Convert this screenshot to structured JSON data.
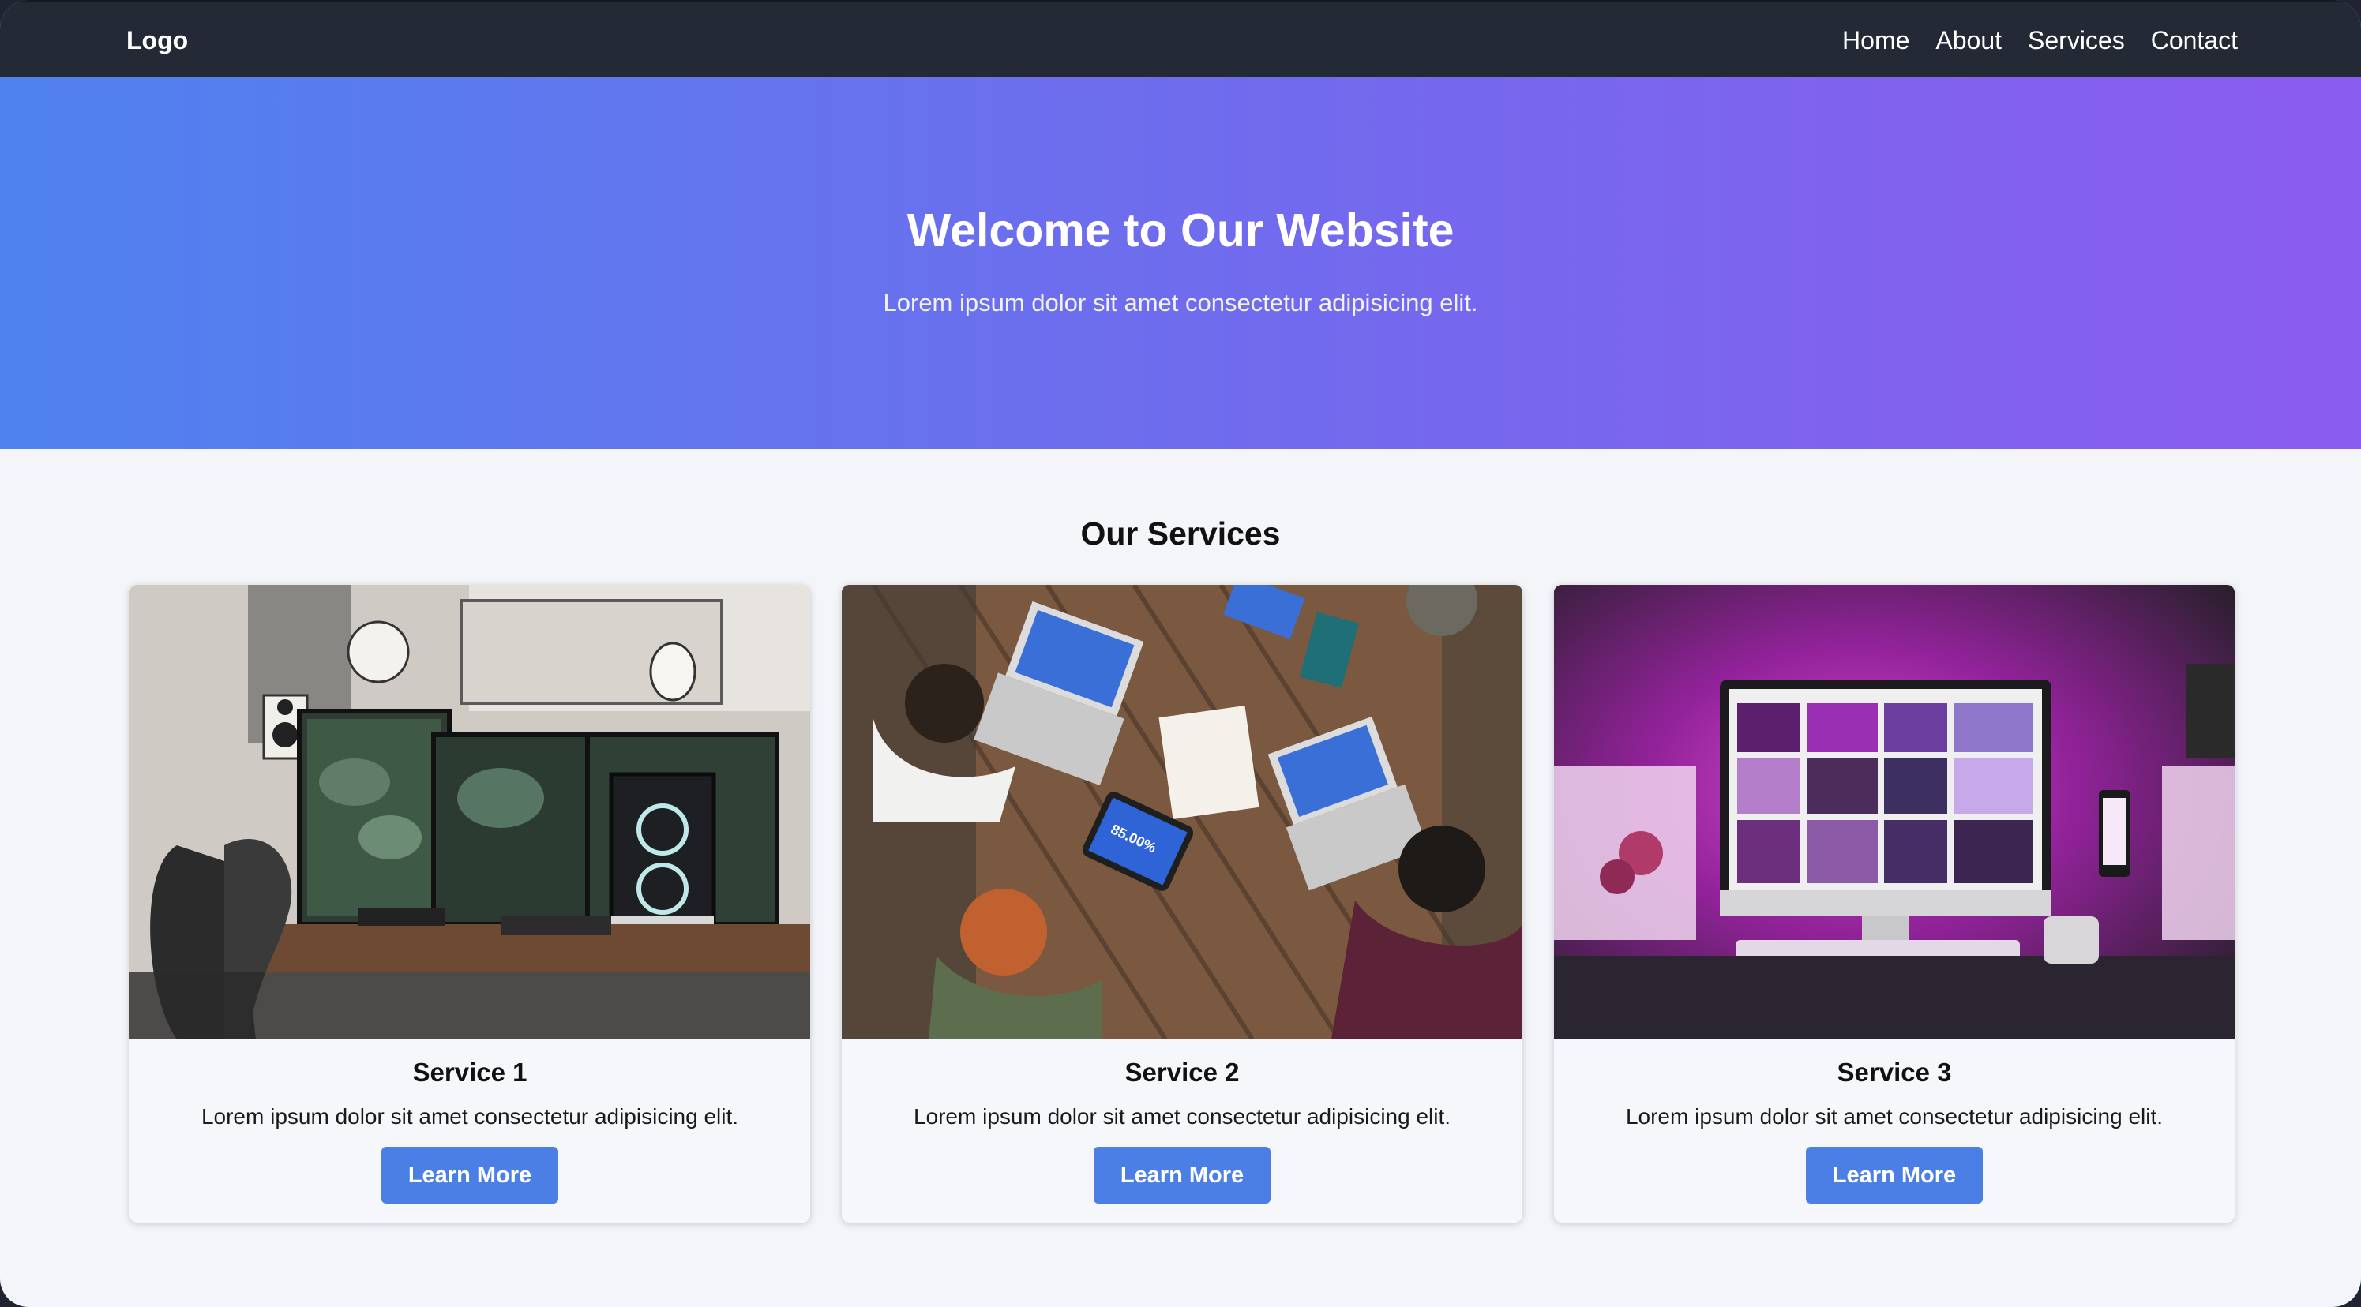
{
  "nav": {
    "logo": "Logo",
    "links": [
      "Home",
      "About",
      "Services",
      "Contact"
    ]
  },
  "hero": {
    "title": "Welcome to Our Website",
    "subtitle": "Lorem ipsum dolor sit amet consectetur adipisicing elit."
  },
  "services": {
    "title": "Our Services",
    "cards": [
      {
        "title": "Service 1",
        "text": "Lorem ipsum dolor sit amet consectetur adipisicing elit.",
        "button": "Learn More",
        "image_icon": "desk-setup-photo"
      },
      {
        "title": "Service 2",
        "text": "Lorem ipsum dolor sit amet consectetur adipisicing elit.",
        "button": "Learn More",
        "image_icon": "team-meeting-photo",
        "tablet_readout": "85.00%"
      },
      {
        "title": "Service 3",
        "text": "Lorem ipsum dolor sit amet consectetur adipisicing elit.",
        "button": "Learn More",
        "image_icon": "pink-workspace-photo"
      }
    ]
  },
  "colors": {
    "nav_bg": "#232a35",
    "hero_gradient_start": "#4f82ef",
    "hero_gradient_end": "#8b5cf0",
    "page_bg": "#f3f5f9",
    "button_bg": "#4c7fe6"
  }
}
